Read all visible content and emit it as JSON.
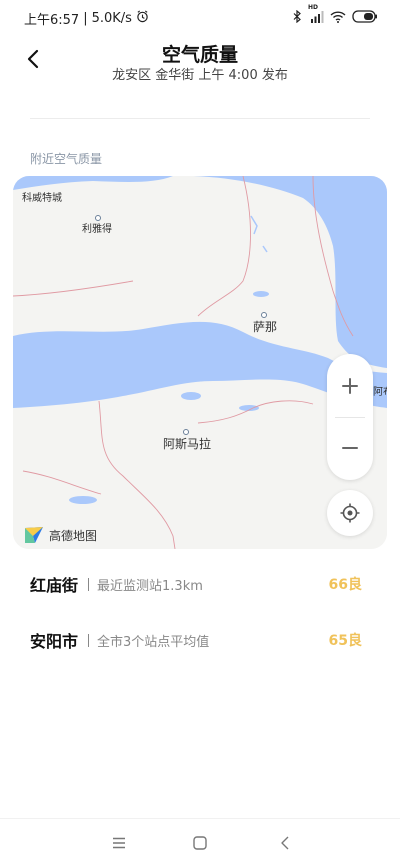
{
  "status_bar": {
    "time": "上午6:57",
    "network_speed": "5.0K/s",
    "icons": [
      "alarm-icon",
      "bluetooth-icon",
      "signal-icon",
      "wifi-icon",
      "battery-icon"
    ],
    "signal_badge": "HD"
  },
  "header": {
    "back_icon": "back-arrow-icon",
    "title": "空气质量",
    "subtitle": "龙安区 金华街 上午 4:00 发布"
  },
  "nearby_section": {
    "title": "附近空气质量"
  },
  "map": {
    "places": [
      {
        "name": "科威特城"
      },
      {
        "name": "利雅得"
      },
      {
        "name": "萨那"
      },
      {
        "name": "阿斯马拉"
      },
      {
        "name": "阿布扎比"
      }
    ],
    "provider": "高德地图",
    "zoom_in_label": "+",
    "zoom_out_label": "−",
    "colors": {
      "water": "#aac8fb",
      "land": "#f4f4f2",
      "border": "#e09aa3"
    }
  },
  "stations": [
    {
      "name": "红庙街",
      "desc": "最近监测站1.3km",
      "aqi": "66良"
    },
    {
      "name": "安阳市",
      "desc": "全市3个站点平均值",
      "aqi": "65良"
    }
  ],
  "nav_bar": {
    "icons": [
      "menu-icon",
      "home-icon",
      "back-icon"
    ]
  },
  "colors": {
    "aqi_good": "#f0c25a",
    "section_title": "#8a96a6"
  }
}
